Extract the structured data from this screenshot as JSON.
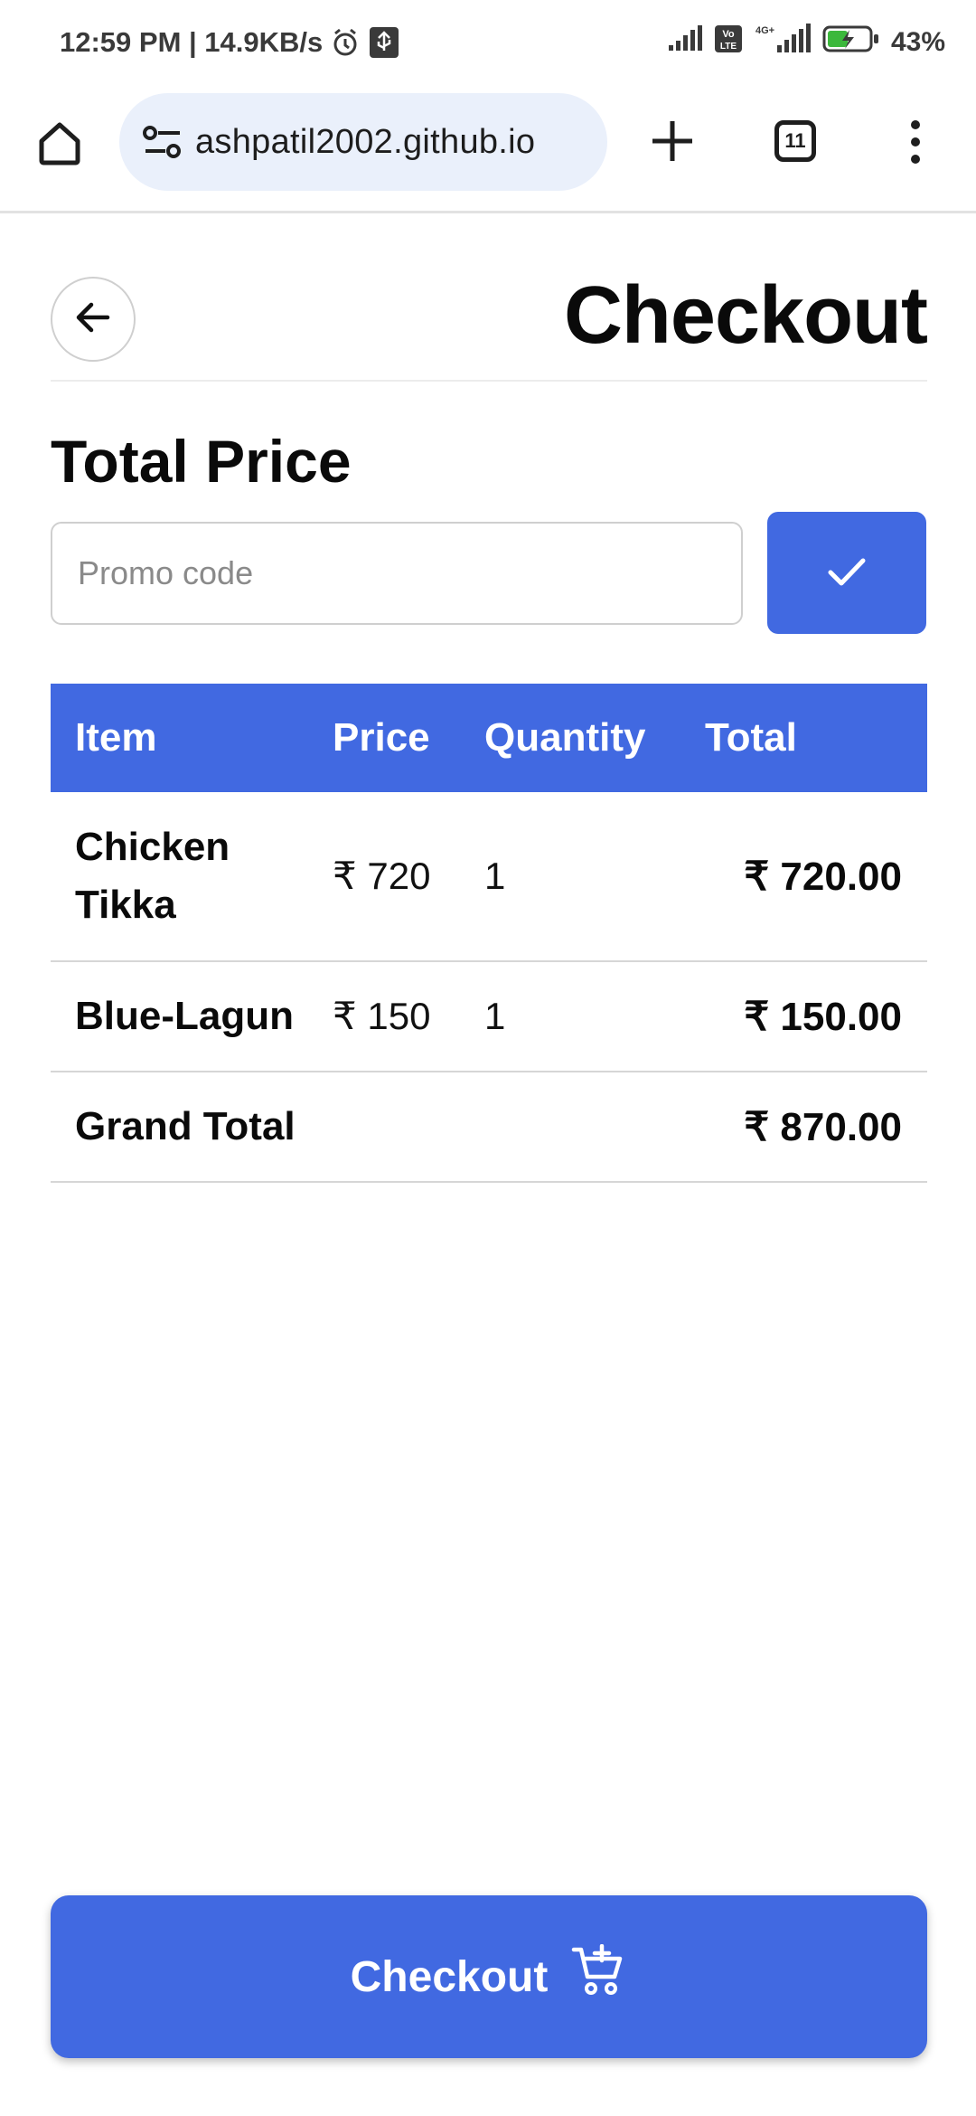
{
  "status_bar": {
    "time_speed": "12:59 PM | 14.9KB/s",
    "network_label": "4G+",
    "volte_label": "Vo LTE",
    "battery": "43%"
  },
  "browser": {
    "url": "ashpatil2002.github.io",
    "tab_count": "11",
    "icons": [
      "home-icon",
      "site-settings-icon",
      "plus-icon",
      "tabs-icon",
      "more-vert-icon"
    ]
  },
  "page": {
    "title": "Checkout",
    "section_title": "Total Price",
    "promo_placeholder": "Promo code",
    "promo_value": ""
  },
  "table": {
    "headers": [
      "Item",
      "Price",
      "Quantity",
      "Total"
    ],
    "rows": [
      {
        "item": "Chicken Tikka",
        "price": "₹ 720",
        "quantity": "1",
        "total": "₹ 720.00"
      },
      {
        "item": "Blue-Lagun",
        "price": "₹ 150",
        "quantity": "1",
        "total": "₹ 150.00"
      }
    ],
    "grand_total_label": "Grand Total",
    "grand_total_value": "₹ 870.00"
  },
  "checkout_button": {
    "label": "Checkout"
  },
  "colors": {
    "accent": "#4169e1",
    "url_bg": "#eaf0fb"
  }
}
